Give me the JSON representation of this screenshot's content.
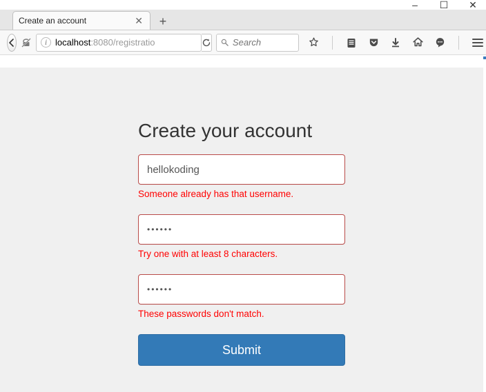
{
  "window": {
    "minimize": "–",
    "maximize": "☐",
    "close": "✕"
  },
  "tab": {
    "title": "Create an account",
    "close": "✕",
    "newtab": "+"
  },
  "toolbar": {
    "back": "←",
    "url_host": "localhost",
    "url_rest": ":8080/registratio",
    "reload": "↻",
    "search_placeholder": "Search"
  },
  "page": {
    "heading": "Create your account",
    "username_value": "hellokoding",
    "username_error": "Someone already has that username.",
    "password_mask": "••••••",
    "password_error": "Try one with at least 8 characters.",
    "confirm_mask": "••••••",
    "confirm_error": "These passwords don't match.",
    "submit_label": "Submit"
  }
}
